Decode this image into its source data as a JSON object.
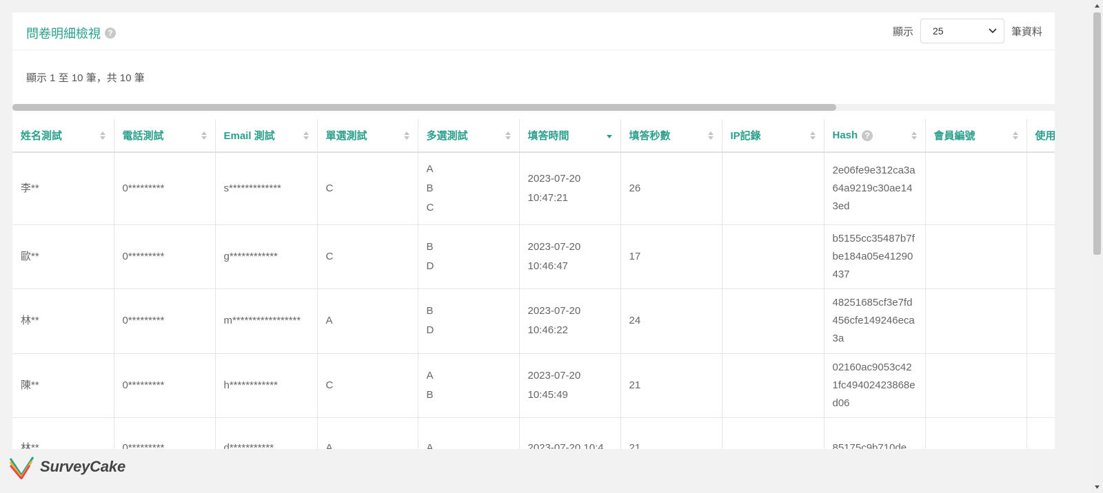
{
  "panel": {
    "title": "問卷明細檢視",
    "help_icon": "question-circle-icon",
    "show_label": "顯示",
    "page_size": "25",
    "records_label": "筆資料",
    "info": "顯示 1 至 10 筆，共 10 筆"
  },
  "table": {
    "columns": [
      "姓名測試",
      "電話測試",
      "Email 測試",
      "單選測試",
      "多選測試",
      "填答時間",
      "填答秒數",
      "IP記錄",
      "Hash",
      "會員編號",
      "使用"
    ],
    "sorted_column": "填答時間",
    "rows": [
      {
        "name": "李**",
        "phone": "0*********",
        "email": "s*************",
        "single": "C",
        "multi": [
          "A",
          "B",
          "C"
        ],
        "time": "2023-07-20 10:47:21",
        "seconds": "26",
        "ip": "",
        "hash": "2e06fe9e312ca3a64a9219c30ae143ed",
        "member": "",
        "use": ""
      },
      {
        "name": "歐**",
        "phone": "0*********",
        "email": "g************",
        "single": "C",
        "multi": [
          "B",
          "D"
        ],
        "time": "2023-07-20 10:46:47",
        "seconds": "17",
        "ip": "",
        "hash": "b5155cc35487b7fbe184a05e41290437",
        "member": "",
        "use": ""
      },
      {
        "name": "林**",
        "phone": "0*********",
        "email": "m*****************",
        "single": "A",
        "multi": [
          "B",
          "D"
        ],
        "time": "2023-07-20 10:46:22",
        "seconds": "24",
        "ip": "",
        "hash": "48251685cf3e7fd456cfe149246eca3a",
        "member": "",
        "use": ""
      },
      {
        "name": "陳**",
        "phone": "0*********",
        "email": "h************",
        "single": "C",
        "multi": [
          "A",
          "B"
        ],
        "time": "2023-07-20 10:45:49",
        "seconds": "21",
        "ip": "",
        "hash": "02160ac9053c421fc49402423868ed06",
        "member": "",
        "use": ""
      },
      {
        "name": "林**",
        "phone": "0*********",
        "email": "d***********",
        "single": "A",
        "multi": [
          "A"
        ],
        "time": "2023-07-20 10:4",
        "seconds": "21",
        "ip": "",
        "hash": "85175c9b710de",
        "member": "",
        "use": ""
      }
    ]
  },
  "footer": {
    "brand": "SurveyCake"
  },
  "colors": {
    "accent": "#2aa08b",
    "text": "#555555"
  }
}
